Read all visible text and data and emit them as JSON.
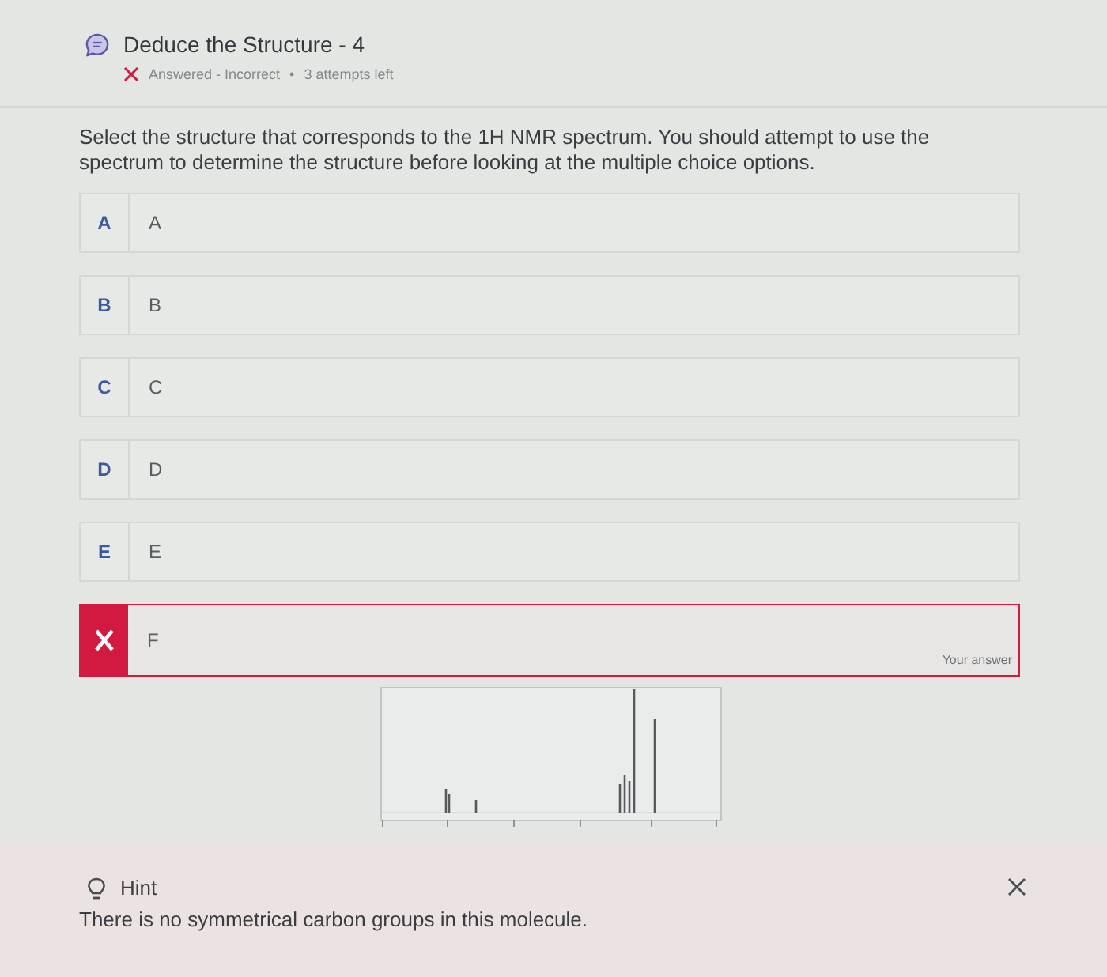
{
  "header": {
    "title": "Deduce the Structure - 4",
    "correct": false,
    "status": "Answered - Incorrect",
    "bullet": "•",
    "attempts": "3 attempts left"
  },
  "question": {
    "prompt": "Select the structure that corresponds to the 1H NMR spectrum. You should attempt to use the spectrum to determine the structure before looking at the multiple choice options.",
    "answer_tag": "Your answer",
    "options": [
      {
        "letter": "A",
        "text": "A",
        "selected": false
      },
      {
        "letter": "B",
        "text": "B",
        "selected": false
      },
      {
        "letter": "C",
        "text": "C",
        "selected": false
      },
      {
        "letter": "D",
        "text": "D",
        "selected": false
      },
      {
        "letter": "E",
        "text": "E",
        "selected": false
      },
      {
        "text": "F",
        "selected": true
      }
    ]
  },
  "hint": {
    "title": "Hint",
    "text": "There is no symmetrical carbon groups in this molecule."
  }
}
